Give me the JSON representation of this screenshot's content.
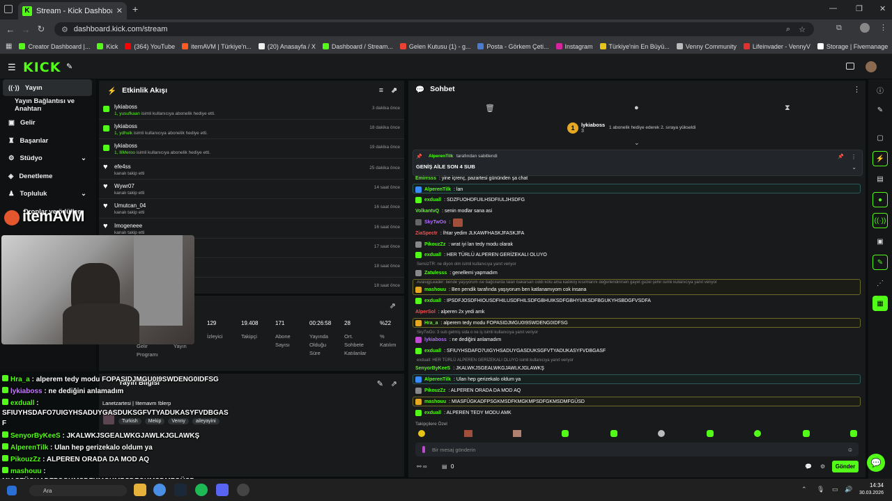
{
  "browser": {
    "tab_title": "Stream - Kick Dashboard",
    "url": "dashboard.kick.com/stream",
    "bookmarks": [
      "Creator Dashboard |...",
      "Kick",
      "(364) YouTube",
      "itemAVM | Türkiye'n...",
      "(20) Anasayfa / X",
      "Dashboard / Stream...",
      "Gelen Kutusu (1) - g...",
      "Posta - Görkem Çeti...",
      "Instagram",
      "Türkiye'nin En Büyü...",
      "Venny Community",
      "Lifeinvader - VennyV",
      "Storage | Fivemanage"
    ]
  },
  "sidebar": {
    "items": [
      "Yayın",
      "Yayın Bağlantısı ve Anahtarı",
      "Gelir",
      "Başarılar",
      "Stüdyo",
      "Denetleme",
      "Topluluk",
      "Droplar ve ödüller"
    ]
  },
  "activity": {
    "title": "Etkinlik Akışı",
    "events": [
      {
        "name": "lykiaboss",
        "detail_user": "1, yusufkaan",
        "detail": " isimli kullanıcıya abonelik hediye etti.",
        "time": "3 dakika önce"
      },
      {
        "name": "lykiaboss",
        "detail_user": "1, ydhulk",
        "detail": " isimli kullanıcıya abonelik hediye etti.",
        "time": "18 dakika önce"
      },
      {
        "name": "lykiaboss",
        "detail_user": "1, lliMeroo",
        "detail": " isimli kullanıcıya abonelik hediye etti.",
        "time": "19 dakika önce"
      },
      {
        "name": "efe4ss",
        "detail_user": "",
        "detail": "kanalı takip etti",
        "time": "25 dakika önce"
      },
      {
        "name": "Wywr07",
        "detail_user": "",
        "detail": "kanalı takip etti",
        "time": "14 saat önce"
      },
      {
        "name": "Umutcan_04",
        "detail_user": "",
        "detail": "kanalı takip etti",
        "time": "16 saat önce"
      },
      {
        "name": "Imogeneee",
        "detail_user": "",
        "detail": "kanalı takip etti",
        "time": "16 saat önce"
      },
      {
        "name": "",
        "detail_user": "",
        "detail": "",
        "time": "17 saat önce"
      },
      {
        "name": "",
        "detail_user": "",
        "detail": "",
        "time": "18 saat önce"
      },
      {
        "name": "",
        "detail_user": "",
        "detail": "",
        "time": "18 saat önce"
      }
    ]
  },
  "stats": {
    "values": [
      "129",
      "19.408",
      "171",
      "00:26:58",
      "28",
      "%22"
    ],
    "labels": [
      "İzleyici",
      "Takipçi",
      "Abone Sayısı",
      "Yayında Olduğu Süre",
      "Ort. Sohbete Katılanlar",
      "% Katılım"
    ],
    "partial_labels": [
      "Gelir Programı",
      "Yayın"
    ]
  },
  "info": {
    "title": "Yayın Bilgisi",
    "stream_title": "Lanetzartesi | !itemavm !blerp",
    "tags": [
      "Turkish",
      "Mekip",
      "Venny",
      "aileyayini"
    ]
  },
  "chat": {
    "title": "Sohbet",
    "pinned_user": "lykiaboss",
    "pinned_count": "3",
    "pinned_text": "1 abonelik hediye ederek 2. sıraya yükseldi",
    "pin_by": "AlperenTilk",
    "pin_by_suffix": "tarafından sabitlendi",
    "pin_msg": "GENİŞ AİLE SON 4 SUB",
    "messages": [
      {
        "u": "Emirrsss",
        "c": "#53fc18",
        "t": ": yine içrenç, pazartesi gününden şa chat"
      },
      {
        "u": "AlperenTilk",
        "c": "#53fc18",
        "t": ": lan"
      },
      {
        "u": "exduall",
        "c": "#53fc18",
        "t": ": SDZFUOHDFUILHSDFIULJHSDFG"
      },
      {
        "u": "VolkantvQ",
        "c": "#53fc18",
        "t": ": senin modlar sana asi"
      },
      {
        "u": "SkyTwOo",
        "c": "#b36bff",
        "t": ":"
      },
      {
        "u": "ZiaSpectr",
        "c": "#ff4d4d",
        "t": ": İhtar yedim JLKAWFHASKJFASKJFA"
      },
      {
        "u": "PikouzZz",
        "c": "#53fc18",
        "t": ": wrat iyi lan tedy modu olarak"
      },
      {
        "u": "exduall",
        "c": "#53fc18",
        "t": ": HER TÜRLÜ ALPEREN GERİZEKALI OLUYO"
      },
      {
        "u": "Zatulesss",
        "c": "#53fc18",
        "t": ": genellemi yapmadım"
      },
      {
        "u": "mashouu",
        "c": "#53fc18",
        "t": ": Ben pendik tarafında yaşıyorum ben katlanamıyom cok insana"
      },
      {
        "u": "exduall",
        "c": "#53fc18",
        "t": ": IPSDFJOSDFHIOUSDFHILUSDFHILSDFGBHUIKSDFGBHYUIKSDFBGUKYHSBDGFVSDFA"
      },
      {
        "u": "AlperSol",
        "c": "#ff4d4d",
        "t": ": alperen 2x yedi amk"
      },
      {
        "u": "Hra_a",
        "c": "#53fc18",
        "t": ": alperem tedy modu FOPASIDJMGU0I9SWDENG0IDFSG"
      },
      {
        "u": "lykiaboss",
        "c": "#b36bff",
        "t": ": ne dediğini anlamadım"
      },
      {
        "u": "exduall",
        "c": "#53fc18",
        "t": ": SFIUYHSDAFO7UIGYHSADUYGASDUKSGFVTYADUKASYFVDBGASF"
      },
      {
        "u": "SenyorByKeeS",
        "c": "#53fc18",
        "t": ": JKALWKJSGEALWKGJAWLKJGLAWKŞ"
      },
      {
        "u": "AlperenTilk",
        "c": "#53fc18",
        "t": ": Ulan hep gerizekalo oldum ya"
      },
      {
        "u": "PikouzZz",
        "c": "#53fc18",
        "t": ": ALPEREN ORADA DA MOD AQ"
      },
      {
        "u": "mashouu",
        "c": "#53fc18",
        "t": ": MIASFÜGKADFPSGKMSDFKMGKMPSDFGKMSDMFGÜSD"
      },
      {
        "u": "exduall",
        "c": "#53fc18",
        "t": ": ALPEREN TEDY MODU AMK"
      }
    ],
    "replies": [
      "SensizTR: ne diyon olm isimli kullanıcıya yanıt veriyor",
      "AvalugjLeader: bende yaşıyorum ise bağcılarda falan bakarsan ciddi kötü ama kadıköy kısımlarını değerlendirirsen gayet güzel şehir isimli kullanıcıya yanıt veriyor",
      "SkyTwOo: 3 sub gelmiş sida o ne iş isimli kullanıcıya yanıt veriyor",
      "exduall: HER TÜRLÜ ALPEREN GERİZEKALI OLUYO isimli kullanıcıya yanıt veriyor"
    ],
    "takip_label": "Takipçilere Özel",
    "input_placeholder": "Bir mesaj gönderin",
    "send_label": "Gönder",
    "count_zero": "0"
  },
  "overlay": {
    "brand": "itemAVM",
    "lines": [
      {
        "u": "Hra_a",
        "c": "#53fc18",
        "t": " : alperem tedy modu FOPASIDJMGU0I9SWDENG0IDFSG"
      },
      {
        "u": "lykiaboss",
        "c": "#c77dff",
        "t": " : ne dediğini anlamadım"
      },
      {
        "u": "exduall",
        "c": "#53fc18",
        "t": " :"
      },
      {
        "u": "",
        "c": "#fff",
        "t": "SFIUYHSDAFO7UIGYHSADUYGASDUKSGFVTYADUKASYFVDBGAS"
      },
      {
        "u": "",
        "c": "#fff",
        "t": "F"
      },
      {
        "u": "SenyorByKeeS",
        "c": "#53fc18",
        "t": " : JKALWKJSGEALWKGJAWLKJGLAWKŞ"
      },
      {
        "u": "AlperenTilk",
        "c": "#53fc18",
        "t": " : Ulan hep gerizekalo oldum ya"
      },
      {
        "u": "PikouzZz",
        "c": "#53fc18",
        "t": " : ALPEREN ORADA DA MOD AQ"
      },
      {
        "u": "mashouu",
        "c": "#53fc18",
        "t": " :"
      },
      {
        "u": "",
        "c": "#fff",
        "t": "MIASFÜGKADFPSGKMSDFKMGKMPSDFGKMSDMFGÜSD"
      },
      {
        "u": "exduall",
        "c": "#53fc18",
        "t": " : ALPEREN TEDY MODU AMK"
      }
    ]
  },
  "taskbar": {
    "search": "Ara",
    "time": "14:34",
    "date": "30.03.2026"
  }
}
